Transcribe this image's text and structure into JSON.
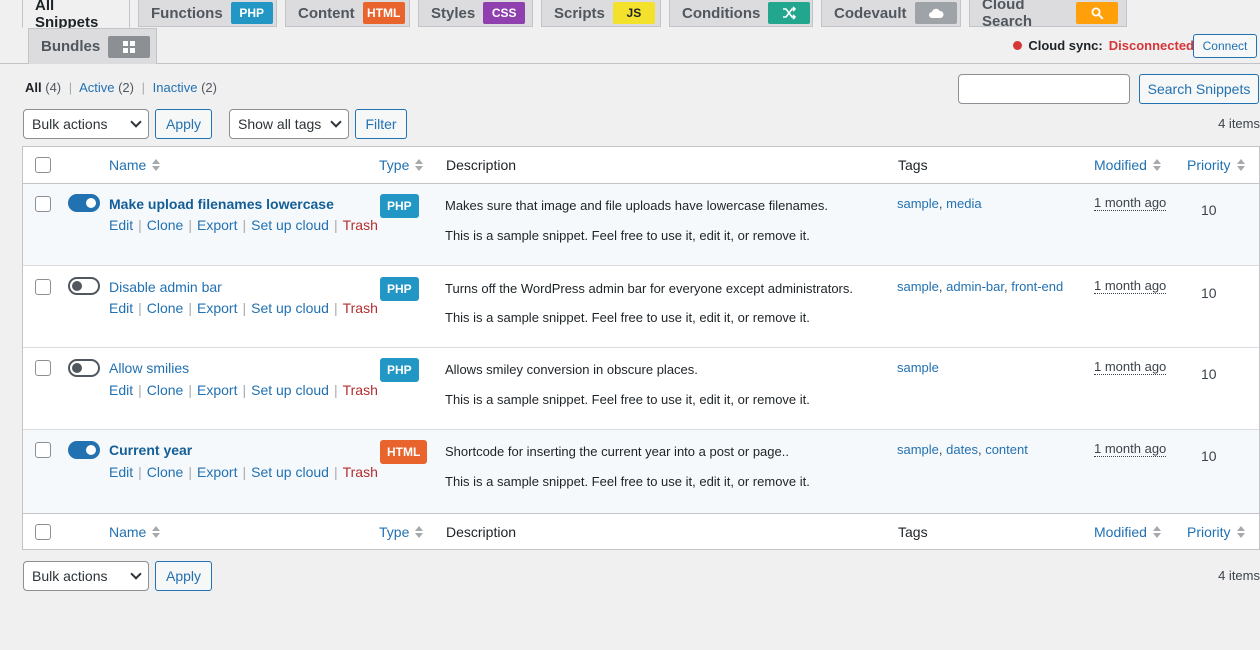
{
  "tabs": [
    {
      "label": "All Snippets",
      "badge": null
    },
    {
      "label": "Functions",
      "badge": "PHP"
    },
    {
      "label": "Content",
      "badge": "HTML"
    },
    {
      "label": "Styles",
      "badge": "CSS"
    },
    {
      "label": "Scripts",
      "badge": "JS"
    },
    {
      "label": "Conditions",
      "badge": "conditions-icon"
    },
    {
      "label": "Codevault",
      "badge": "cloud-icon"
    },
    {
      "label": "Cloud Search",
      "badge": "search-icon"
    },
    {
      "label": "Bundles",
      "badge": "grid-icon"
    }
  ],
  "colors": {
    "php": "#2296c5",
    "html": "#e8642c",
    "css": "#8f3fae",
    "js": "#f4e12c",
    "conditions": "#22a68e",
    "cloud": "#9ea3a8",
    "search": "#ffa00b",
    "bundles": "#8c8f94",
    "accent": "#2271b1",
    "danger": "#d63638"
  },
  "cloud_sync": {
    "label": "Cloud sync:",
    "status": "Disconnected",
    "connect": "Connect"
  },
  "views": {
    "all": "All",
    "all_count": "(4)",
    "active": "Active",
    "active_count": "(2)",
    "inactive": "Inactive",
    "inactive_count": "(2)"
  },
  "search": {
    "button": "Search Snippets"
  },
  "toolbar": {
    "bulk": "Bulk actions",
    "apply": "Apply",
    "tags": "Show all tags",
    "filter": "Filter",
    "items": "4 items"
  },
  "columns": {
    "name": "Name",
    "type": "Type",
    "description": "Description",
    "tags": "Tags",
    "modified": "Modified",
    "priority": "Priority"
  },
  "row_actions": {
    "edit": "Edit",
    "clone": "Clone",
    "export": "Export",
    "cloud": "Set up cloud",
    "trash": "Trash"
  },
  "snippets": [
    {
      "name": "Make upload filenames lowercase",
      "active": true,
      "type": "PHP",
      "desc": "Makes sure that image and file uploads have lowercase filenames.",
      "desc2": "This is a sample snippet. Feel free to use it, edit it, or remove it.",
      "tags": [
        "sample",
        "media"
      ],
      "modified": "1 month ago",
      "priority": "10"
    },
    {
      "name": "Disable admin bar",
      "active": false,
      "type": "PHP",
      "desc": "Turns off the WordPress admin bar for everyone except administrators.",
      "desc2": "This is a sample snippet. Feel free to use it, edit it, or remove it.",
      "tags": [
        "sample",
        "admin-bar",
        "front-end"
      ],
      "modified": "1 month ago",
      "priority": "10"
    },
    {
      "name": "Allow smilies",
      "active": false,
      "type": "PHP",
      "desc": "Allows smiley conversion in obscure places.",
      "desc2": "This is a sample snippet. Feel free to use it, edit it, or remove it.",
      "tags": [
        "sample"
      ],
      "modified": "1 month ago",
      "priority": "10"
    },
    {
      "name": "Current year",
      "active": true,
      "type": "HTML",
      "desc": "Shortcode for inserting the current year into a post or page..",
      "desc2": "This is a sample snippet. Feel free to use it, edit it, or remove it.",
      "tags": [
        "sample",
        "dates",
        "content"
      ],
      "modified": "1 month ago",
      "priority": "10"
    }
  ]
}
